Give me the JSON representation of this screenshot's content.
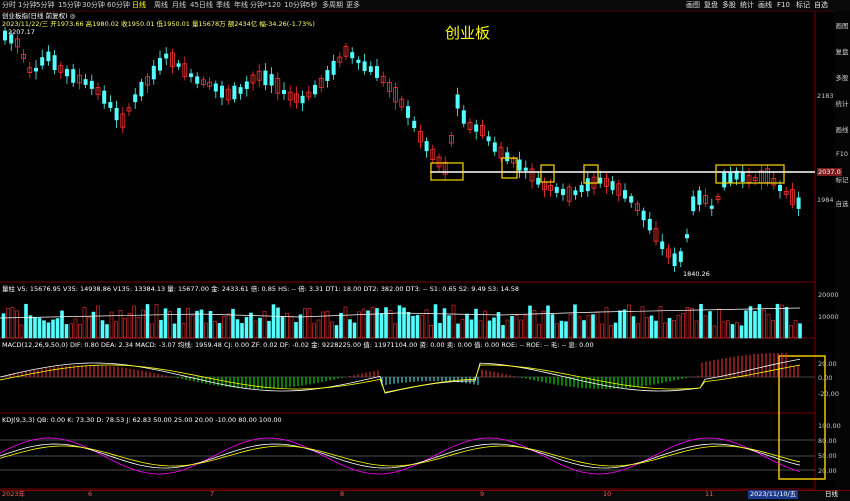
{
  "toolbar": {
    "tabs": [
      "分时",
      "1分钟",
      "5分钟",
      "15分钟",
      "30分钟",
      "60分钟",
      "日线",
      "周线",
      "月线",
      "45日线",
      "季线",
      "年线",
      "分钟*120",
      "10分钟",
      "5秒",
      "多周期",
      "更多"
    ],
    "active_tab": "日线",
    "right_tabs": [
      "画图",
      "复盘",
      "多股",
      "统计",
      "画线",
      "F10",
      "标记",
      "自选"
    ]
  },
  "title": "创业板",
  "info_line1": "创业板指(日线 前复权) ◎",
  "info_line2": "2023/11/22/三  开1973.66  高1980.02  收1950.01  低1950.01  量15678万  额2434亿  幅-34.26(-1.73%)",
  "info_line3": "2207.17",
  "price_axis": {
    "p2183": "2183",
    "p2037": "2037.0",
    "p1984": "1984"
  },
  "price_labels": {
    "high": "2207.17",
    "low": "1840.26"
  },
  "volume_header": "量柱  V5: 15676.95  V35: 14938.86  V135: 13384.13  量: 15677.00  金: 2433.61  倍: 0.85  HS: --  倍: 3.31  DT1: 18.00  DT2: 382.00  DT3: --  S1: 0.65  S2: 9.49  S3: 14.58",
  "volume_axis": {
    "v20000": "20000",
    "v10000": "10000"
  },
  "macd_header": "MACD(12,26,9,50,0)  DIF: 0.80  DEA: 2.34  MACD: -3.07  均线: 1959.48  CJ: 0.00  ZF: 0.02  DF: -0.02  金: 9228225.00  值: 11971104.00  资: 0.00  卖: 0.00  值: 0.00  ROE: --  ROE: --  毛: --  息: 0.00",
  "macd_axis": {
    "m20": "20.00",
    "m0": "0.00",
    "mneg20": "-20.00"
  },
  "kdj_header": "KDJ(9,3,3)  QB: 0.00  K: 73.30  D: 78.53  J: 62.83  50.00  25.00  20.00  -10.00  80.00  100.00",
  "kdj_axis": {
    "k100": "100.00",
    "k80": "80.00",
    "k50": "50.00",
    "k20": "20.00"
  },
  "date_axis": [
    "2023年",
    "6",
    "7",
    "8",
    "9",
    "10",
    "11"
  ],
  "date_highlight": "2023/11/10/五",
  "date_right": "日线",
  "sidebar_items": [
    "画图",
    "复盘",
    "多股",
    "统计",
    "画线",
    "F10",
    "标记",
    "自选"
  ],
  "colors": {
    "up": "#ff3232",
    "down": "#54ffff",
    "ma1": "#ffffff",
    "ma2": "#ffff00",
    "ma3": "#ff00ff",
    "ma4": "#00ff00",
    "highlight": "#ffd700",
    "support": "#ffffff"
  }
}
